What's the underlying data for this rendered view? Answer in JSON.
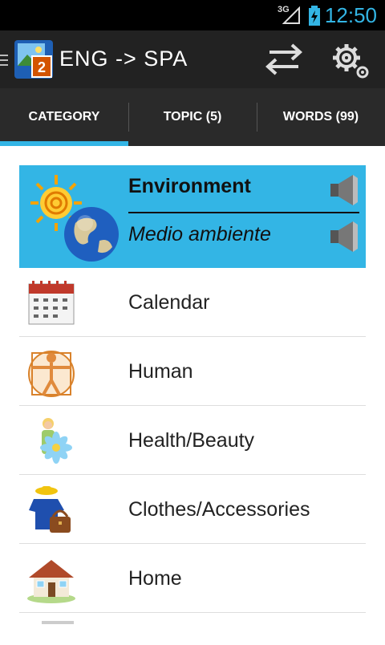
{
  "status_bar": {
    "network": "3G",
    "time": "12:50"
  },
  "action_bar": {
    "title": "ENG -> SPA",
    "swap_icon": "swap-arrows-icon",
    "settings_icon": "gear-icon"
  },
  "tabs": [
    {
      "label": "CATEGORY",
      "active": true
    },
    {
      "label": "TOPIC (5)",
      "active": false
    },
    {
      "label": "WORDS (99)",
      "active": false
    }
  ],
  "selected": {
    "english": "Environment",
    "spanish": "Medio ambiente",
    "icon": "sun-globe-icon"
  },
  "categories": [
    {
      "label": "Calendar",
      "icon": "calendar-icon"
    },
    {
      "label": "Human",
      "icon": "vitruvian-man-icon"
    },
    {
      "label": "Health/Beauty",
      "icon": "woman-flower-icon"
    },
    {
      "label": "Clothes/Accessories",
      "icon": "clothes-icon"
    },
    {
      "label": "Home",
      "icon": "house-icon"
    }
  ],
  "colors": {
    "accent": "#33b5e5",
    "action_bar": "#222222",
    "tabs": "#2a2a2a"
  }
}
